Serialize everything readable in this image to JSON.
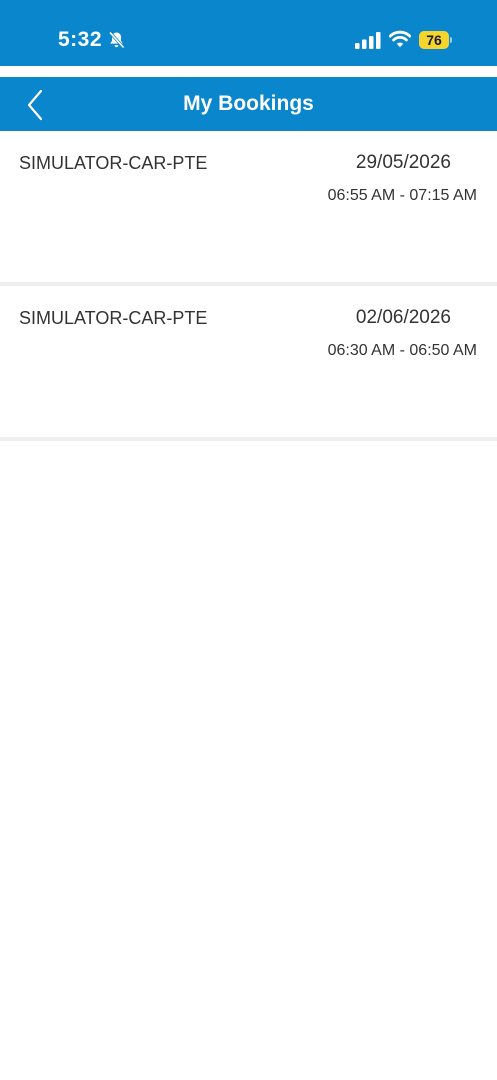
{
  "status_bar": {
    "time": "5:32",
    "battery": "76",
    "icons": [
      "bell-slash-icon",
      "signal-icon",
      "wifi-icon",
      "battery-icon"
    ]
  },
  "header": {
    "title": "My Bookings",
    "back_icon": "chevron-left-icon"
  },
  "bookings": [
    {
      "name": "SIMULATOR-CAR-PTE",
      "date": "29/05/2026",
      "time": "06:55 AM - 07:15 AM"
    },
    {
      "name": "SIMULATOR-CAR-PTE",
      "date": "02/06/2026",
      "time": "06:30 AM - 06:50 AM"
    }
  ],
  "colors": {
    "primary": "#0a86cc",
    "battery": "#f5d52d",
    "divider": "#efefef",
    "text": "#333333"
  }
}
